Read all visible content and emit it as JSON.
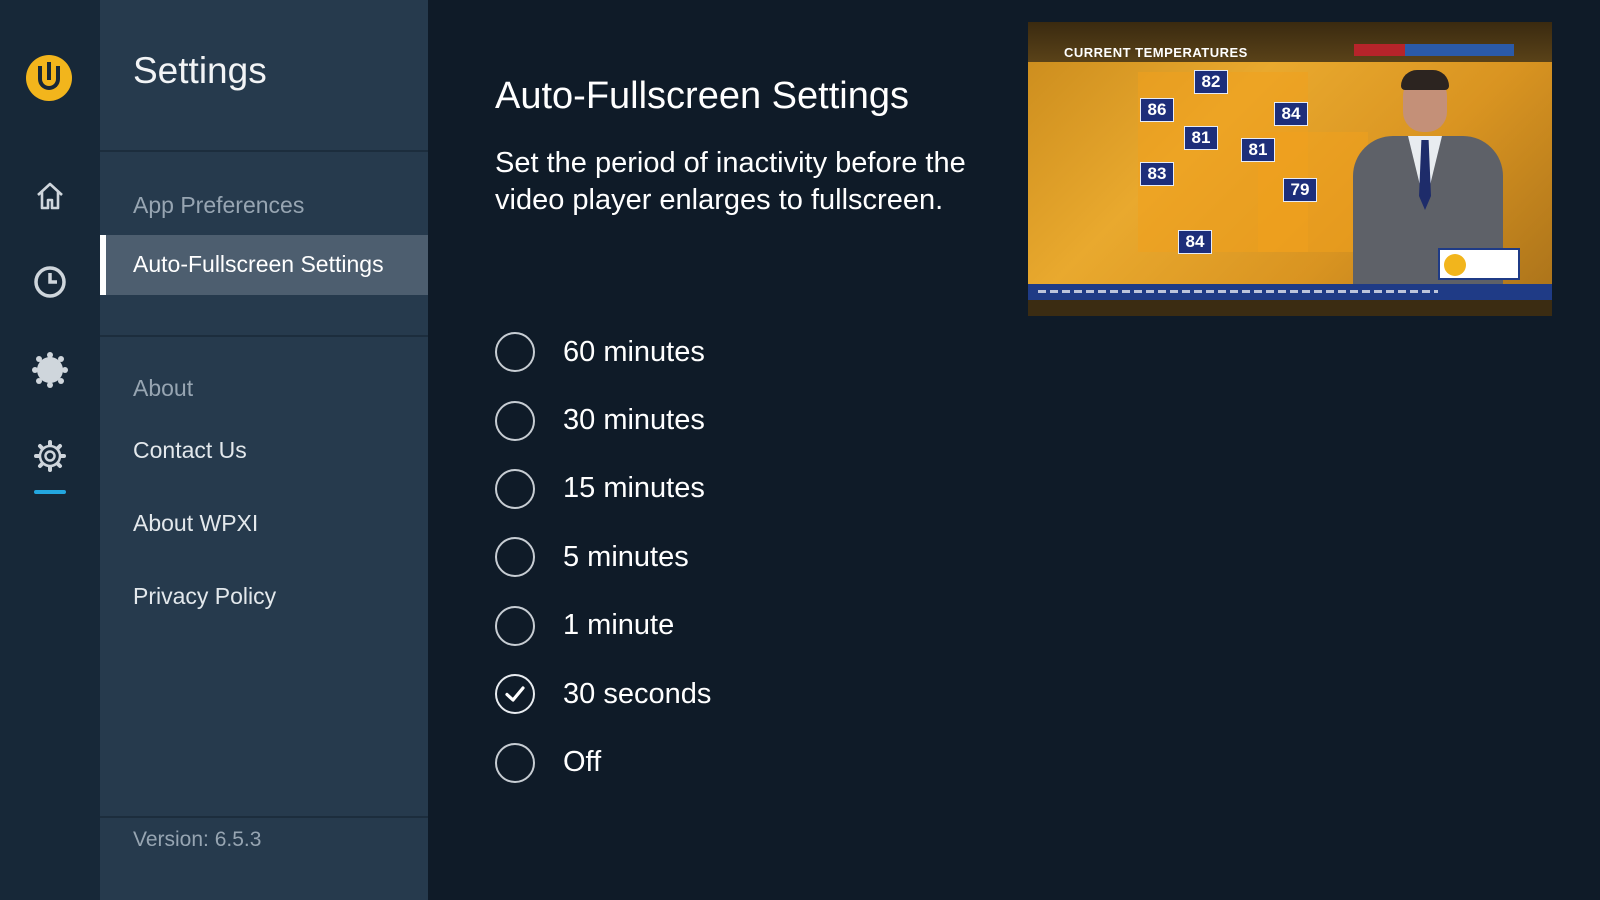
{
  "rail": {
    "items": [
      {
        "icon": "home-icon"
      },
      {
        "icon": "clock-icon"
      },
      {
        "icon": "weather-icon"
      },
      {
        "icon": "gear-icon",
        "active": true
      }
    ]
  },
  "sidebar": {
    "title": "Settings",
    "sections": [
      {
        "label": "App Preferences"
      },
      {
        "label": "About"
      }
    ],
    "items": [
      {
        "label": "Auto-Fullscreen Settings",
        "active": true
      },
      {
        "label": "Contact Us"
      },
      {
        "label": "About WPXI"
      },
      {
        "label": "Privacy Policy"
      }
    ],
    "version": "Version: 6.5.3"
  },
  "main": {
    "title": "Auto-Fullscreen Settings",
    "description": "Set the period of inactivity before the video player enlarges to fullscreen.",
    "options": [
      {
        "label": "60 minutes",
        "selected": false
      },
      {
        "label": "30 minutes",
        "selected": false
      },
      {
        "label": "15 minutes",
        "selected": false
      },
      {
        "label": "5 minutes",
        "selected": false
      },
      {
        "label": "1 minute",
        "selected": false
      },
      {
        "label": "30 seconds",
        "selected": true
      },
      {
        "label": "Off",
        "selected": false
      }
    ]
  },
  "video": {
    "banner": "CURRENT TEMPERATURES",
    "temps": [
      "82",
      "86",
      "84",
      "81",
      "81",
      "83",
      "79",
      "84"
    ]
  },
  "colors": {
    "accent": "#f2b51c",
    "underline": "#23a7e0",
    "panel": "#263a4d",
    "background": "#0f1b28"
  }
}
